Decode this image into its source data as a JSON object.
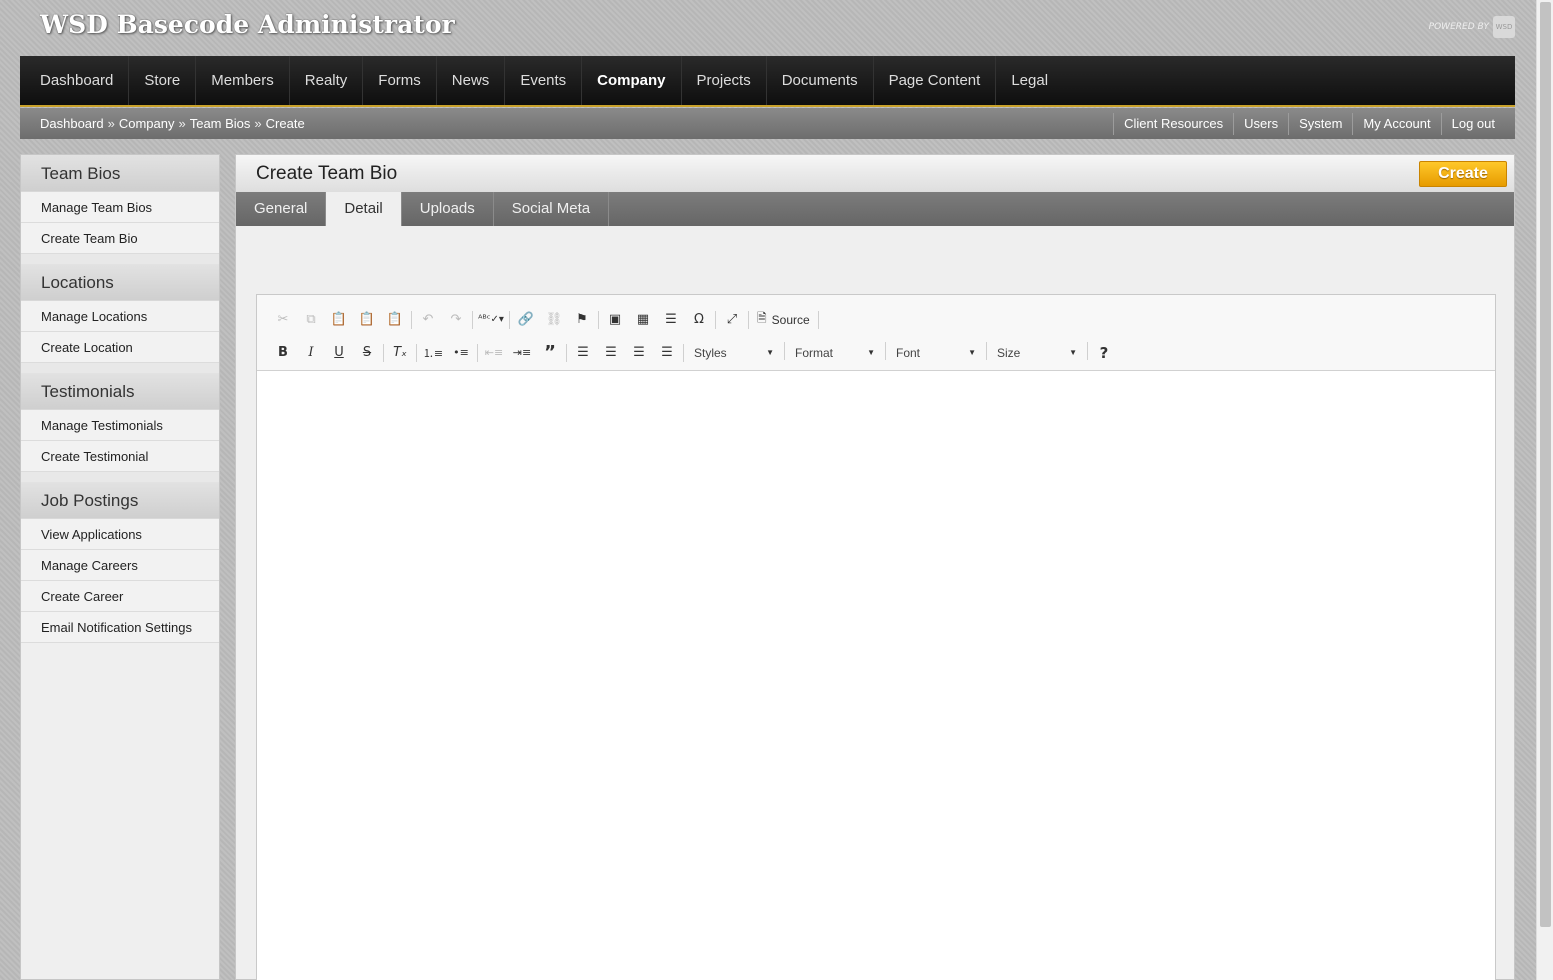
{
  "app": {
    "title": "WSD Basecode Administrator",
    "powered_by": "POWERED BY",
    "logo_text": "WSD"
  },
  "mainnav": [
    {
      "label": "Dashboard"
    },
    {
      "label": "Store"
    },
    {
      "label": "Members"
    },
    {
      "label": "Realty"
    },
    {
      "label": "Forms"
    },
    {
      "label": "News"
    },
    {
      "label": "Events"
    },
    {
      "label": "Company",
      "active": true
    },
    {
      "label": "Projects"
    },
    {
      "label": "Documents"
    },
    {
      "label": "Page Content"
    },
    {
      "label": "Legal"
    }
  ],
  "breadcrumb": [
    "Dashboard",
    "Company",
    "Team Bios",
    "Create"
  ],
  "breadcrumb_sep": "»",
  "utility": [
    "Client Resources",
    "Users",
    "System",
    "My Account",
    "Log out"
  ],
  "sidebar": [
    {
      "heading": "Team Bios",
      "links": [
        "Manage Team Bios",
        "Create Team Bio"
      ]
    },
    {
      "heading": "Locations",
      "links": [
        "Manage Locations",
        "Create Location"
      ]
    },
    {
      "heading": "Testimonials",
      "links": [
        "Manage Testimonials",
        "Create Testimonial"
      ]
    },
    {
      "heading": "Job Postings",
      "links": [
        "View Applications",
        "Manage Careers",
        "Create Career",
        "Email Notification Settings"
      ]
    }
  ],
  "panel": {
    "title": "Create Team Bio",
    "create_label": "Create",
    "tabs": [
      {
        "label": "General"
      },
      {
        "label": "Detail",
        "active": true
      },
      {
        "label": "Uploads"
      },
      {
        "label": "Social Meta"
      }
    ]
  },
  "editor": {
    "source_label": "Source",
    "combos": [
      "Styles",
      "Format",
      "Font",
      "Size"
    ],
    "help_label": "?"
  },
  "colors": {
    "accent": "#c8a12a",
    "create_button": "#f5b400"
  }
}
